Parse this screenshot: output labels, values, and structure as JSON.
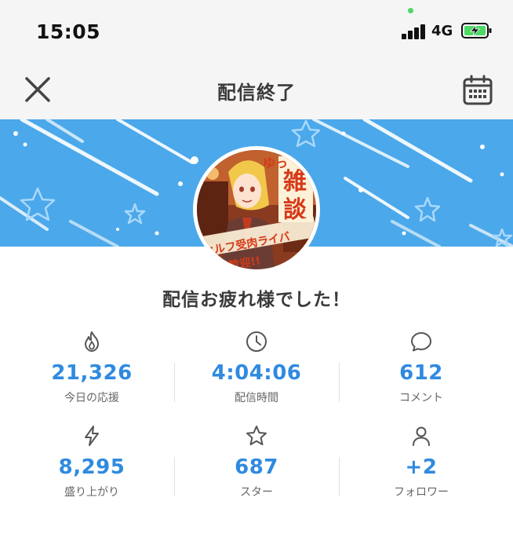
{
  "status_bar": {
    "time": "15:05",
    "network": "4G",
    "icons": [
      "signal-icon",
      "battery-charging-icon"
    ]
  },
  "nav": {
    "title": "配信終了",
    "close_icon": "close-icon",
    "calendar_icon": "calendar-icon"
  },
  "avatar": {
    "texts": [
      "ゆっ",
      "雑",
      "談",
      "セルフ受肉ライバ",
      "様歓迎!!"
    ]
  },
  "message": "配信お疲れ様でした！",
  "stats": [
    {
      "icon": "flame-icon",
      "value": "21,326",
      "label": "今日の応援"
    },
    {
      "icon": "clock-icon",
      "value": "4:04:06",
      "label": "配信時間"
    },
    {
      "icon": "comment-icon",
      "value": "612",
      "label": "コメント"
    },
    {
      "icon": "lightning-icon",
      "value": "8,295",
      "label": "盛り上がり"
    },
    {
      "icon": "star-icon",
      "value": "687",
      "label": "スター"
    },
    {
      "icon": "person-icon",
      "value": "+2",
      "label": "フォロワー"
    }
  ],
  "colors": {
    "accent": "#2f8ae0",
    "banner": "#4ba8ea",
    "background": "#ffffff",
    "nav_background": "#f5f5f5"
  }
}
